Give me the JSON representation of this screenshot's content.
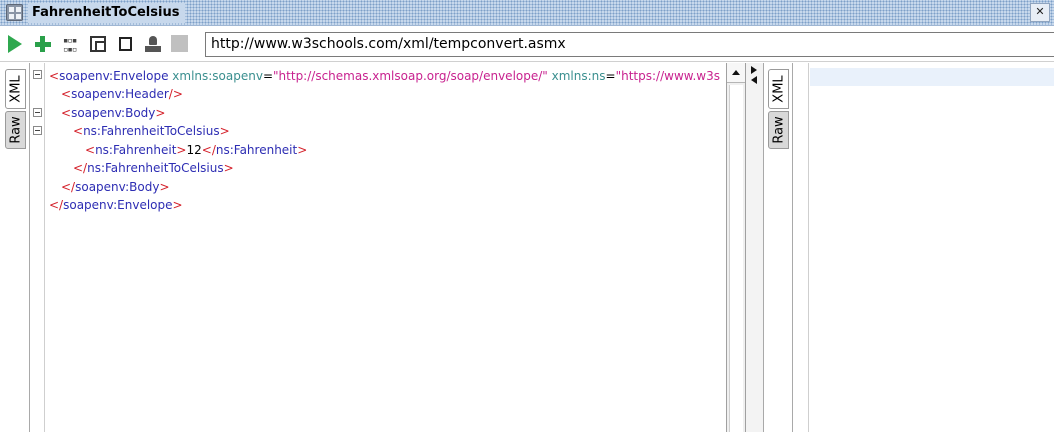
{
  "window": {
    "title": "FahrenheitToCelsius",
    "close_label": "✕"
  },
  "toolbar": {
    "url": "http://www.w3schools.com/xml/tempconvert.asmx",
    "icons": [
      "play-icon",
      "add-icon",
      "grid-icon",
      "expand-icon",
      "square-icon",
      "stamp-icon",
      "stop-icon"
    ]
  },
  "request_panel": {
    "tabs": [
      {
        "label": "XML",
        "active": true
      },
      {
        "label": "Raw",
        "active": false
      }
    ],
    "lines": [
      {
        "open": "<",
        "tag": "soapenv:Envelope",
        "attr1_name": "xmlns:soapenv",
        "attr1_eq": "=",
        "attr1_val": "\"http://schemas.xmlsoap.org/soap/envelope/\"",
        "attr2_name": "xmlns:ns",
        "attr2_eq": "=",
        "attr2_val": "\"https://www.w3s"
      },
      {
        "open": "<",
        "tag": "soapenv:Header",
        "close": "/>"
      },
      {
        "open": "<",
        "tag": "soapenv:Body",
        "close": ">"
      },
      {
        "open": "<",
        "tag": "ns:FahrenheitToCelsius",
        "close": ">"
      },
      {
        "open": "<",
        "tag": "ns:Fahrenheit",
        "close": ">",
        "text": "12",
        "endopen": "</",
        "endtag": "ns:Fahrenheit",
        "endclose": ">"
      },
      {
        "open": "</",
        "tag": "ns:FahrenheitToCelsius",
        "close": ">"
      },
      {
        "open": "</",
        "tag": "soapenv:Body",
        "close": ">"
      },
      {
        "open": "</",
        "tag": "soapenv:Envelope",
        "close": ">"
      }
    ]
  },
  "response_panel": {
    "tabs": [
      {
        "label": "XML",
        "active": true
      },
      {
        "label": "Raw",
        "active": false
      }
    ]
  }
}
